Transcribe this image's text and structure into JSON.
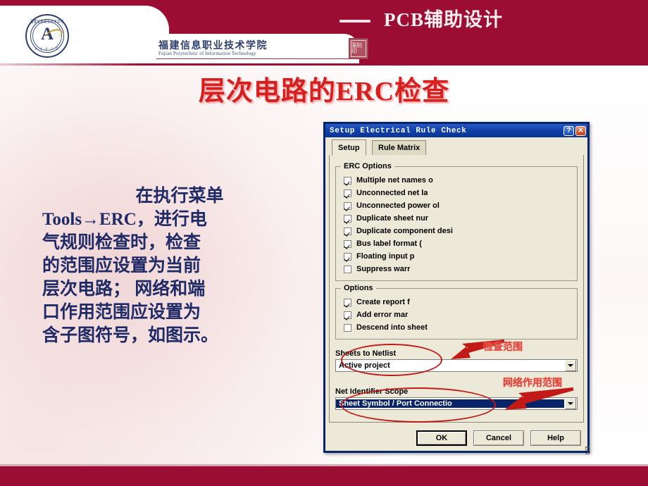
{
  "header": {
    "title": "PCB辅助设计",
    "dash": "——",
    "school_cn": "福建信息职业技术学院",
    "school_en": "Fujian Polytechnic of Information Technology",
    "logo_abbr": "F J P I T",
    "logo_mark": "A",
    "logo_arc_text": "福建信息职业技术学院",
    "seal_text": "篆刻印",
    "band_color": "#9c0d33"
  },
  "slide": {
    "title": "层次电路的ERC检查",
    "title_color": "#d62020",
    "page_number": "5",
    "body_lines": [
      "在执行菜单",
      "Tools→ERC，进行电",
      "气规则检查时，检查",
      "的范围应设置为当前",
      "层次电路； 网络和端",
      "口作用范围应设置为",
      "含子图符号，如图示。"
    ]
  },
  "dialog": {
    "title": "Setup Electrical Rule Check",
    "titlebar_help": "?",
    "titlebar_close": "✕",
    "tabs": [
      {
        "label": "Setup",
        "active": true
      },
      {
        "label": "Rule Matrix",
        "active": false
      }
    ],
    "erc_options": {
      "legend": "ERC Options",
      "items": [
        {
          "label": "Multiple net names o",
          "checked": true
        },
        {
          "label": "Unconnected net la",
          "checked": true
        },
        {
          "label": "Unconnected power ol",
          "checked": true
        },
        {
          "label": "Duplicate sheet nur",
          "checked": true
        },
        {
          "label": "Duplicate component desi",
          "checked": true
        },
        {
          "label": "Bus label format (",
          "checked": true
        },
        {
          "label": "Floating input p",
          "checked": true
        },
        {
          "label": "Suppress warr",
          "checked": false
        }
      ]
    },
    "options": {
      "legend": "Options",
      "items": [
        {
          "label": "Create report f",
          "checked": true
        },
        {
          "label": "Add error mar",
          "checked": true
        },
        {
          "label": "Descend into sheet",
          "checked": false
        }
      ]
    },
    "sheets_to_netlist": {
      "label": "Sheets to Netlist",
      "value": "Active project"
    },
    "net_identifier_scope": {
      "label": "Net Identifier Scope",
      "value": "Sheet Symbol / Port Connectio"
    },
    "buttons": {
      "ok": "OK",
      "cancel": "Cancel",
      "help": "Help"
    }
  },
  "annotations": {
    "scope_note": "检查范围",
    "net_scope_note": "网络作用范围",
    "highlight_color": "#c21b17"
  }
}
